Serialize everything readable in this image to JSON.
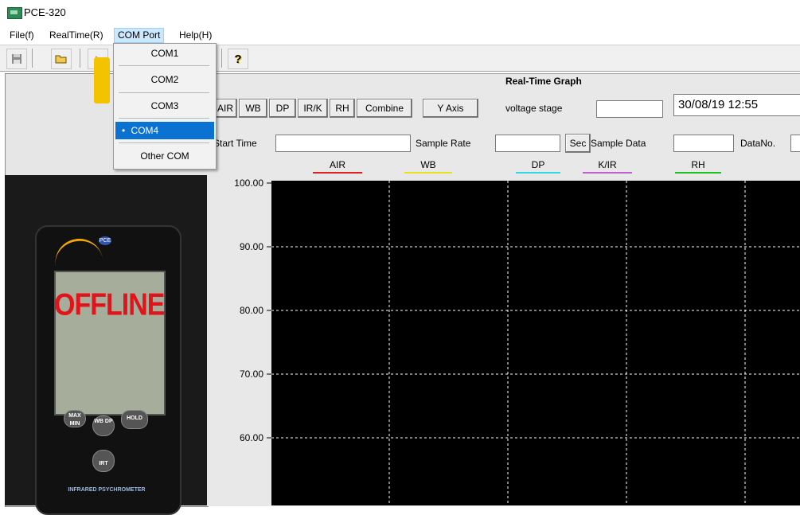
{
  "window": {
    "title": "PCE-320"
  },
  "menu": [
    {
      "label": "File(f)"
    },
    {
      "label": "RealTime(R)"
    },
    {
      "label": "COM Port"
    },
    {
      "label": "Help(H)"
    }
  ],
  "dropdown": {
    "items": [
      "COM1",
      "COM2",
      "COM3",
      "COM4",
      "Other COM"
    ],
    "selected_index": 3,
    "selected_bullet": "•"
  },
  "device": {
    "lcd_text": "OFFLINE",
    "brand_badge": "PCE",
    "buttons": {
      "max_min": "MAX MIN",
      "wb_dp": "WB DP",
      "hold": "HOLD",
      "irt": "IRT"
    },
    "model_label": "INFRARED PSYCHROMETER"
  },
  "graph": {
    "title": "Real-Time Graph",
    "series_buttons": [
      "AIR",
      "WB",
      "DP",
      "IR/K",
      "RH",
      "Combine"
    ],
    "y_axis_button": "Y Axis",
    "voltage_label": "voltage stage",
    "datetime": "30/08/19 12:55",
    "start_time_label": "Start Time",
    "sample_rate_label": "Sample Rate",
    "sec_button": "Sec",
    "sample_data_label": "Sample Data",
    "datano_label": "DataNo."
  },
  "chart_data": {
    "type": "line",
    "title": "",
    "series": [
      {
        "name": "AIR",
        "color": "#e02020",
        "values": []
      },
      {
        "name": "WB",
        "color": "#e8e020",
        "values": []
      },
      {
        "name": "DP",
        "color": "#30d8e8",
        "values": []
      },
      {
        "name": "K/IR",
        "color": "#c060d0",
        "values": []
      },
      {
        "name": "RH",
        "color": "#20c020",
        "values": []
      }
    ],
    "y_ticks": [
      "100.00",
      "90.00",
      "80.00",
      "70.00",
      "60.00"
    ],
    "ylim": [
      60,
      100
    ],
    "grid": true,
    "background": "#000000",
    "grid_color": "#ffffff"
  }
}
